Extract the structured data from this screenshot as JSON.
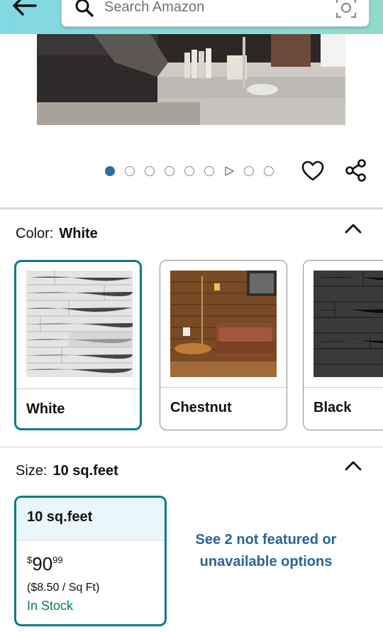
{
  "header": {
    "search_placeholder": "Search Amazon"
  },
  "carousel": {
    "total_items": 9,
    "active_index": 0,
    "video_index": 6
  },
  "color": {
    "label": "Color:",
    "selected": "White",
    "options": [
      {
        "name": "White"
      },
      {
        "name": "Chestnut"
      },
      {
        "name": "Black"
      }
    ]
  },
  "size": {
    "label": "Size:",
    "selected": "10 sq.feet",
    "option": {
      "name": "10 sq.feet",
      "currency": "$",
      "price_whole": "90",
      "price_fraction": "99",
      "unit_price": "($8.50 / Sq Ft)",
      "stock": "In Stock"
    },
    "see_more": "See 2 not featured or unavailable options"
  },
  "colors": {
    "accent": "#0a7a8c",
    "link": "#2a6496",
    "in_stock": "#067d62",
    "dot_active": "#2d6ea6"
  }
}
